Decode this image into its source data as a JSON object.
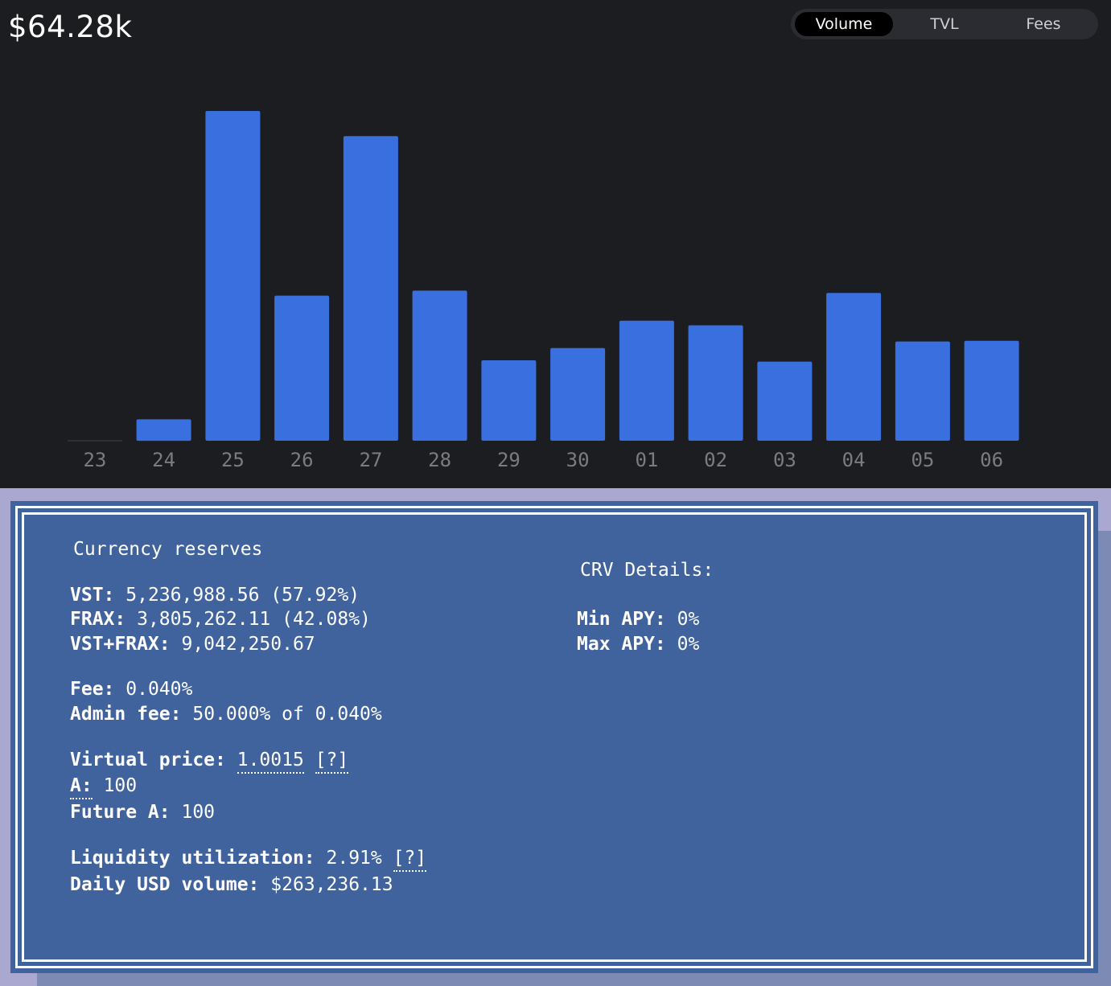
{
  "header": {
    "value": "$64.28k"
  },
  "tabs": {
    "volume": "Volume",
    "tvl": "TVL",
    "fees": "Fees",
    "selected": "Volume"
  },
  "colors": {
    "bar": "#3a6fdf",
    "axis_text": "#7b7c82",
    "panel_bg": "#40639e",
    "chart_bg": "#1c1d21"
  },
  "chart_data": {
    "type": "bar",
    "categories": [
      "23",
      "24",
      "25",
      "26",
      "27",
      "28",
      "29",
      "30",
      "01",
      "02",
      "03",
      "04",
      "05",
      "06"
    ],
    "values": [
      0,
      6.5,
      100,
      44,
      92.4,
      45.5,
      24.4,
      28.1,
      36.4,
      35,
      24,
      44.8,
      30.1,
      30.3
    ],
    "title": "",
    "xlabel": "",
    "ylabel": "",
    "ylim": [
      0,
      100
    ],
    "grid": false,
    "legend": "none"
  },
  "info": {
    "reserves_title": "Currency reserves",
    "vst_label": "VST:",
    "vst_value": "5,236,988.56 (57.92%)",
    "frax_label": "FRAX:",
    "frax_value": "3,805,262.11 (42.08%)",
    "total_label": "VST+FRAX:",
    "total_value": "9,042,250.67",
    "fee_label": "Fee:",
    "fee_value": "0.040%",
    "admin_fee_label": "Admin fee:",
    "admin_fee_value": "50.000% of 0.040%",
    "virtual_price_label": "Virtual price:",
    "virtual_price_value": "1.0015",
    "help_1": "[?]",
    "a_label": "A:",
    "a_value": "100",
    "future_a_label": "Future A:",
    "future_a_value": "100",
    "liquidity_label": "Liquidity utilization:",
    "liquidity_value": "2.91%",
    "help_2": "[?]",
    "daily_volume_label": "Daily USD volume:",
    "daily_volume_value": "$263,236.13",
    "crv_title": "CRV Details:",
    "min_apy_label": "Min APY:",
    "min_apy_value": "0%",
    "max_apy_label": "Max APY:",
    "max_apy_value": "0%"
  }
}
